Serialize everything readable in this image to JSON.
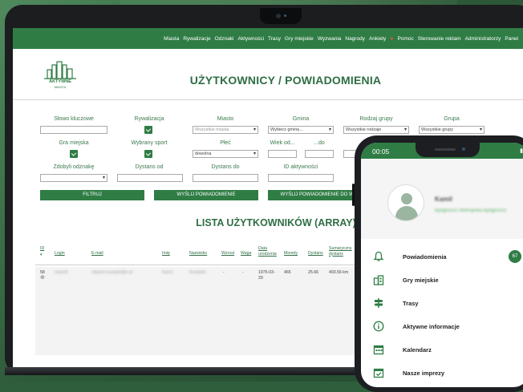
{
  "nav": {
    "items": [
      "Miasta",
      "Rywalizacje",
      "Odznaki",
      "Aktywności",
      "Trasy",
      "Gry miejskie",
      "Wyzwania",
      "Nagrody",
      "Ankiety",
      "Pomoc",
      "Sterowanie reklam",
      "Administratorzy",
      "Panel"
    ]
  },
  "logo": {
    "line1": "AKTYWNE",
    "line2": "MIASTA"
  },
  "page": {
    "title": "UŻYTKOWNICY / POWIADOMIENIA",
    "list_title": "LISTA UŻYTKOWNIKÓW (ARRAY)"
  },
  "filters": {
    "keyword_label": "Słowo kluczowe",
    "rivalry_label": "Rywalizacja",
    "city_label": "Miasto",
    "city_value": "Wszystkie miasta",
    "commune_label": "Gmina",
    "commune_value": "Wybierz gminę...",
    "group_type_label": "Rodzaj grupy",
    "group_type_value": "Wszystkie rodzaje",
    "group_label": "Grupa",
    "group_value": "Wszystkie grupy",
    "city_game_label": "Gra miejska",
    "sport_label": "Wybrany sport",
    "gender_label": "Płeć",
    "gender_value": "dowolna",
    "age_from_label": "Wiek od...",
    "age_to_label": "...do",
    "date_label": "Data od",
    "badges_label": "Zdobyli odznakę",
    "distance_from_label": "Dystans od",
    "distance_to_label": "Dystans do",
    "activity_id_label": "ID aktywności"
  },
  "buttons": {
    "filter": "FILTRUJ",
    "send_notification": "WYŚLIJ POWIADOMIENIE",
    "send_notification_all": "WYŚLIJ POWIADOMIENIE DO WSZ"
  },
  "table": {
    "headers": [
      "ID",
      "Login",
      "E-mail",
      "Imię",
      "Nazwisko",
      "Wzrost",
      "Waga",
      "Data urodzenia",
      "Monety",
      "Dystans",
      "Sumaryczny dystans"
    ],
    "row": {
      "id": "58",
      "login": "mkamil",
      "email": "mkamil.example@o.pl",
      "first_name": "Kamil",
      "last_name": "Kowalski",
      "height": "-",
      "weight": "-",
      "birth_date": "1975-03-29",
      "coins": "465",
      "distance": "25.66",
      "total_distance": "493.56 km"
    }
  },
  "phone": {
    "time": "00:05",
    "user_name": "Kamil",
    "user_subtitle": "Bydgoszcz Metropolia Bydgoszcz",
    "menu": [
      {
        "label": "Powiadomienia",
        "icon": "bell-icon",
        "badge": "67"
      },
      {
        "label": "Gry miejskie",
        "icon": "city-icon"
      },
      {
        "label": "Trasy",
        "icon": "signpost-icon"
      },
      {
        "label": "Aktywne informacje",
        "icon": "info-icon"
      },
      {
        "label": "Kalendarz",
        "icon": "calendar-icon"
      },
      {
        "label": "Nasze imprezy",
        "icon": "event-icon"
      }
    ]
  },
  "colors": {
    "brand": "#2f7d45",
    "title": "#2f6e45",
    "label": "#3d7a4f"
  }
}
